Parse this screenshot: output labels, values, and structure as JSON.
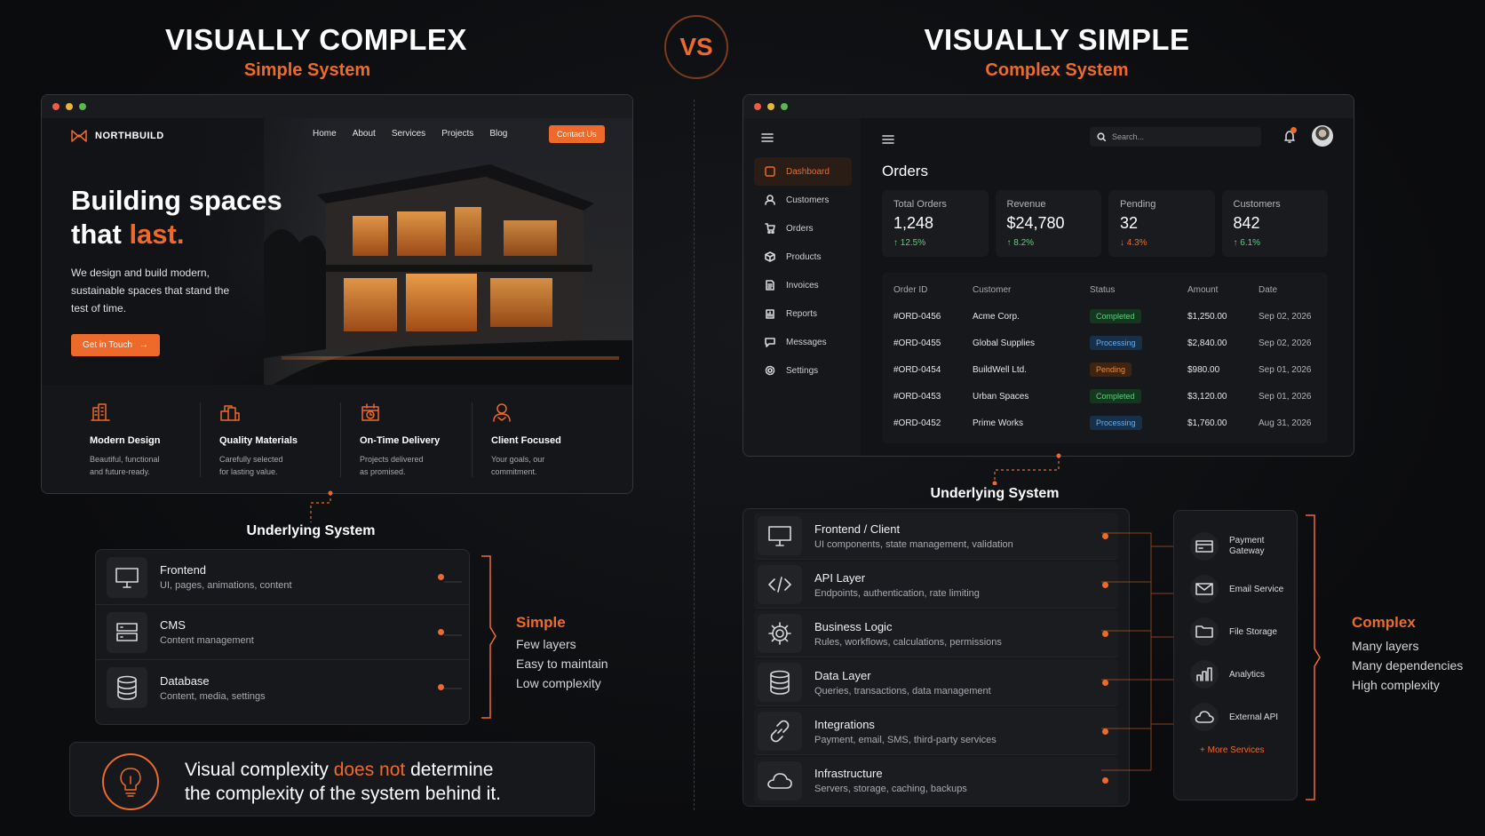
{
  "left": {
    "heading": "VISUALLY COMPLEX",
    "subheading": "Simple System",
    "site": {
      "brand": "NORTHBUILD",
      "nav": [
        "Home",
        "About",
        "Services",
        "Projects",
        "Blog"
      ],
      "contact_button": "Contact Us",
      "hero_line1": "Building spaces",
      "hero_line2a": "that ",
      "hero_line2b": "last.",
      "hero_text": "We design and build modern, sustainable spaces that stand the test of time.",
      "cta": "Get in Touch",
      "features": [
        {
          "title": "Modern Design",
          "desc": "Beautiful, functional\nand future-ready."
        },
        {
          "title": "Quality Materials",
          "desc": "Carefully selected\nfor lasting value."
        },
        {
          "title": "On-Time Delivery",
          "desc": "Projects delivered\nas promised."
        },
        {
          "title": "Client Focused",
          "desc": "Your goals, our\ncommitment."
        }
      ]
    },
    "underlying_title": "Underlying System",
    "layers": [
      {
        "title": "Frontend",
        "desc": "UI, pages, animations, content",
        "icon": "monitor-icon"
      },
      {
        "title": "CMS",
        "desc": "Content management",
        "icon": "server-icon"
      },
      {
        "title": "Database",
        "desc": "Content, media, settings",
        "icon": "database-icon"
      }
    ],
    "summary": {
      "title": "Simple",
      "lines": [
        "Few layers",
        "Easy to maintain",
        "Low complexity"
      ]
    },
    "callout": {
      "part1": "Visual complexity ",
      "highlight": "does not",
      "part2": " determine",
      "line2": "the complexity of the system behind it."
    }
  },
  "vs": "VS",
  "right": {
    "heading": "VISUALLY SIMPLE",
    "subheading": "Complex System",
    "dashboard": {
      "sidebar": [
        "Dashboard",
        "Customers",
        "Orders",
        "Products",
        "Invoices",
        "Reports",
        "Messages",
        "Settings"
      ],
      "search_placeholder": "Search...",
      "title": "Orders",
      "stats": [
        {
          "label": "Total Orders",
          "value": "1,248",
          "change": "↑ 12.5%",
          "dir": "up"
        },
        {
          "label": "Revenue",
          "value": "$24,780",
          "change": "↑ 8.2%",
          "dir": "up"
        },
        {
          "label": "Pending",
          "value": "32",
          "change": "↓ 4.3%",
          "dir": "down"
        },
        {
          "label": "Customers",
          "value": "842",
          "change": "↑ 6.1%",
          "dir": "up"
        }
      ],
      "table_headers": [
        "Order ID",
        "Customer",
        "Status",
        "Amount",
        "Date"
      ],
      "rows": [
        {
          "id": "#ORD-0456",
          "customer": "Acme Corp.",
          "status": "Completed",
          "amount": "$1,250.00",
          "date": "Sep 02, 2026"
        },
        {
          "id": "#ORD-0455",
          "customer": "Global Supplies",
          "status": "Processing",
          "amount": "$2,840.00",
          "date": "Sep 02, 2026"
        },
        {
          "id": "#ORD-0454",
          "customer": "BuildWell Ltd.",
          "status": "Pending",
          "amount": "$980.00",
          "date": "Sep 01, 2026"
        },
        {
          "id": "#ORD-0453",
          "customer": "Urban Spaces",
          "status": "Completed",
          "amount": "$3,120.00",
          "date": "Sep 01, 2026"
        },
        {
          "id": "#ORD-0452",
          "customer": "Prime Works",
          "status": "Processing",
          "amount": "$1,760.00",
          "date": "Aug 31, 2026"
        }
      ]
    },
    "underlying_title": "Underlying System",
    "layers": [
      {
        "title": "Frontend / Client",
        "desc": "UI components, state management, validation",
        "icon": "monitor-icon"
      },
      {
        "title": "API Layer",
        "desc": "Endpoints, authentication, rate limiting",
        "icon": "code-icon"
      },
      {
        "title": "Business Logic",
        "desc": "Rules, workflows, calculations, permissions",
        "icon": "gear-icon"
      },
      {
        "title": "Data Layer",
        "desc": "Queries, transactions, data management",
        "icon": "database-icon"
      },
      {
        "title": "Integrations",
        "desc": "Payment, email, SMS, third-party services",
        "icon": "link-icon"
      },
      {
        "title": "Infrastructure",
        "desc": "Servers, storage, caching, backups",
        "icon": "cloud-icon"
      }
    ],
    "services": [
      {
        "name": "Payment\nGateway",
        "icon": "card-icon"
      },
      {
        "name": "Email Service",
        "icon": "mail-icon"
      },
      {
        "name": "File Storage",
        "icon": "folder-icon"
      },
      {
        "name": "Analytics",
        "icon": "bar-chart-icon"
      },
      {
        "name": "External API",
        "icon": "cloud-icon"
      }
    ],
    "more_services": "+ More Services",
    "summary": {
      "title": "Complex",
      "lines": [
        "Many layers",
        "Many dependencies",
        "High complexity"
      ]
    }
  }
}
